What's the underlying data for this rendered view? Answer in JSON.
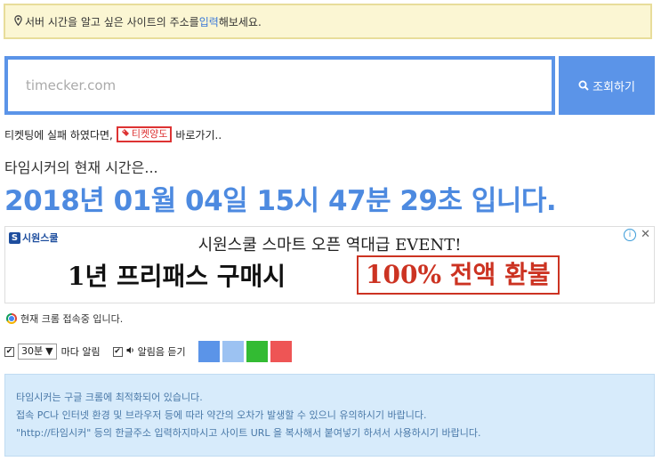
{
  "notice": {
    "icon": "map-pin-icon",
    "text_before": "서버 시간을 알고 싶은 사이트의 주소를 ",
    "highlight": "입력",
    "text_after": "해보세요."
  },
  "search": {
    "placeholder": "timecker.com",
    "value": "",
    "button_label": "조회하기"
  },
  "ticket": {
    "prefix": "티켓팅에 실패 하였다면,",
    "badge_label": "티켓양도",
    "link_label": "바로가기.."
  },
  "current_time": {
    "label": "타임시커의 현재 시간은...",
    "display": "2018년 01월 04일 15시 47분 29초 입니다."
  },
  "ad": {
    "brand": "시원스쿨",
    "brand_mark": "S",
    "headline": "시원스쿨 스마트 오픈 역대급 EVENT!",
    "main_text": "1년 프리패스 구매시",
    "refund_text": "100% 전액 환불",
    "info_symbol": "i",
    "close_symbol": "✕"
  },
  "browser": {
    "text": "현재 크롬 접속중 입니다."
  },
  "controls": {
    "alarm_checked": true,
    "interval_value": "30분",
    "alarm_label": "마다 알림",
    "sound_checked": true,
    "sound_label": "알림음 듣기",
    "colors": [
      "#5b94e8",
      "#9cc2f2",
      "#33bb33",
      "#ee5555"
    ]
  },
  "info": {
    "lines": [
      "타임시커는 구글 크롬에 최적화되어 있습니다.",
      "접속 PC나 인터넷 환경 및 브라우저 등에 따라 약간의 오차가 발생할 수 있으니 유의하시기 바랍니다.",
      "\"http://타임시커\" 등의 한글주소 입력하지마시고 사이트 URL 을 복사해서 붙여넣기 하셔서 사용하시기 바랍니다."
    ]
  }
}
